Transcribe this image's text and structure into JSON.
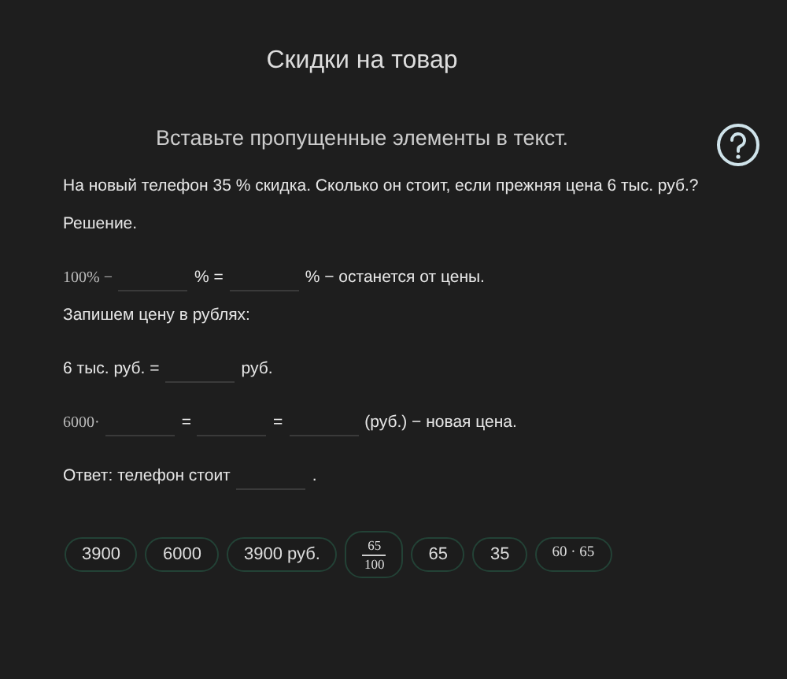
{
  "title": "Скидки на товар",
  "instruction": "Вставьте пропущенные элементы в текст.",
  "lines": [
    [
      {
        "kind": "text",
        "text": "На новый телефон 35 % скидка. Сколько он стоит, если прежняя цена 6 тыс. руб.?"
      }
    ],
    [
      {
        "kind": "text",
        "text": "Решение."
      }
    ],
    [
      {
        "kind": "serif",
        "text": "100% −"
      },
      {
        "kind": "blank"
      },
      {
        "kind": "text",
        "text": "% ="
      },
      {
        "kind": "blank"
      },
      {
        "kind": "text",
        "text": "% − останется от цены."
      }
    ],
    [
      {
        "kind": "text",
        "text": "Запишем цену в рублях:"
      }
    ],
    [
      {
        "kind": "text",
        "text": "6 тыс. руб. ="
      },
      {
        "kind": "blank"
      },
      {
        "kind": "text",
        "text": "руб."
      }
    ],
    [
      {
        "kind": "serif",
        "text": "6000·"
      },
      {
        "kind": "blank"
      },
      {
        "kind": "text",
        "text": "="
      },
      {
        "kind": "blank"
      },
      {
        "kind": "text",
        "text": "="
      },
      {
        "kind": "blank"
      },
      {
        "kind": "text",
        "text": "(руб.) − новая цена."
      }
    ],
    [
      {
        "kind": "text",
        "text": "Ответ: телефон стоит"
      },
      {
        "kind": "blank"
      },
      {
        "kind": "text",
        "text": "."
      }
    ]
  ],
  "chips": [
    {
      "kind": "text",
      "text": "3900"
    },
    {
      "kind": "text",
      "text": "6000"
    },
    {
      "kind": "text",
      "text": "3900 руб."
    },
    {
      "kind": "fraction",
      "numerator": "65",
      "denominator": "100"
    },
    {
      "kind": "text",
      "text": "65"
    },
    {
      "kind": "text",
      "text": "35"
    },
    {
      "kind": "serif",
      "text": "60 · 65"
    }
  ]
}
